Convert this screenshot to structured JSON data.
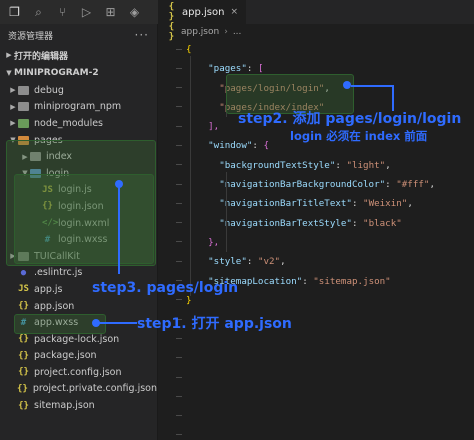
{
  "activity_bar": {
    "icons": [
      "files-icon",
      "search-icon",
      "source-control-icon",
      "debug-icon",
      "extensions-icon",
      "docker-icon"
    ]
  },
  "sidebar": {
    "title": "资源管理器",
    "more": "···",
    "open_editors": "打开的编辑器",
    "project": "MINIPROGRAM-2",
    "tree": [
      {
        "label": "debug",
        "type": "folder",
        "icon": "folder",
        "depth": 0
      },
      {
        "label": "miniprogram_npm",
        "type": "folder",
        "icon": "folder",
        "depth": 0
      },
      {
        "label": "node_modules",
        "type": "folder",
        "icon": "folder-green",
        "depth": 0
      },
      {
        "label": "pages",
        "type": "folder",
        "icon": "folder-orange",
        "depth": 0,
        "open": true
      },
      {
        "label": "index",
        "type": "folder",
        "icon": "folder",
        "depth": 1
      },
      {
        "label": "login",
        "type": "folder",
        "icon": "folder-blue",
        "depth": 1,
        "open": true
      },
      {
        "label": "login.js",
        "type": "file",
        "icon": "js",
        "depth": 2
      },
      {
        "label": "login.json",
        "type": "file",
        "icon": "json",
        "depth": 2
      },
      {
        "label": "login.wxml",
        "type": "file",
        "icon": "wxml",
        "depth": 2
      },
      {
        "label": "login.wxss",
        "type": "file",
        "icon": "wxss",
        "depth": 2
      },
      {
        "label": "TUICallKit",
        "type": "folder",
        "icon": "folder",
        "depth": 0
      },
      {
        "label": ".eslintrc.js",
        "type": "file",
        "icon": "eslint",
        "depth": 0
      },
      {
        "label": "app.js",
        "type": "file",
        "icon": "js",
        "depth": 0
      },
      {
        "label": "app.json",
        "type": "file",
        "icon": "json",
        "depth": 0
      },
      {
        "label": "app.wxss",
        "type": "file",
        "icon": "wxss",
        "depth": 0
      },
      {
        "label": "package-lock.json",
        "type": "file",
        "icon": "json",
        "depth": 0
      },
      {
        "label": "package.json",
        "type": "file",
        "icon": "json",
        "depth": 0
      },
      {
        "label": "project.config.json",
        "type": "file",
        "icon": "json",
        "depth": 0
      },
      {
        "label": "project.private.config.json",
        "type": "file",
        "icon": "json",
        "depth": 0
      },
      {
        "label": "sitemap.json",
        "type": "file",
        "icon": "json",
        "depth": 0
      }
    ]
  },
  "editor": {
    "tab_label": "app.json",
    "tab_close": "×",
    "breadcrumb_file": "app.json",
    "breadcrumb_sep": "›",
    "breadcrumb_tail": "...",
    "json_glyph": "{ }",
    "code": {
      "l1": "{",
      "pages_key": "\"pages\"",
      "pages_open": "[",
      "page1": "\"pages/login/login\"",
      "page2": "\"pages/index/index\"",
      "pages_close": "],",
      "window_key": "\"window\"",
      "window_open": "{",
      "bts_key": "\"backgroundTextStyle\"",
      "bts_val": "\"light\"",
      "nbbc_key": "\"navigationBarBackgroundColor\"",
      "nbbc_val": "\"#fff\"",
      "nbtt_key": "\"navigationBarTitleText\"",
      "nbtt_val": "\"Weixin\"",
      "nbts_key": "\"navigationBarTextStyle\"",
      "nbts_val": "\"black\"",
      "window_close": "},",
      "style_key": "\"style\"",
      "style_val": "\"v2\"",
      "sitemap_key": "\"sitemapLocation\"",
      "sitemap_val": "\"sitemap.json\"",
      "last": "}"
    }
  },
  "annotations": {
    "step1": "step1. 打开 app.json",
    "step2": "step2. 添加 pages/login/login",
    "step2_note": "login 必须在 index 前面",
    "step3": "step3. pages/login"
  },
  "colors": {
    "accent": "#2f6bff",
    "highlight": "#3c6e37"
  }
}
